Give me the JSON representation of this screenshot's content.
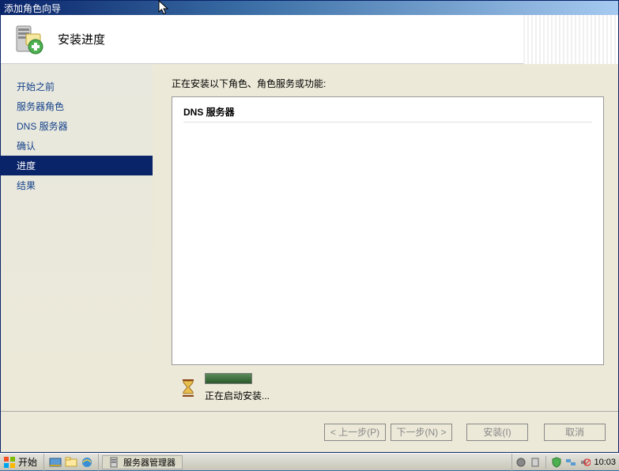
{
  "window": {
    "title": "添加角色向导",
    "header_title": "安装进度"
  },
  "sidebar": {
    "items": [
      {
        "label": "开始之前"
      },
      {
        "label": "服务器角色"
      },
      {
        "label": "DNS 服务器"
      },
      {
        "label": "确认"
      },
      {
        "label": "进度"
      },
      {
        "label": "结果"
      }
    ],
    "active_index": 4
  },
  "main": {
    "intro": "正在安装以下角色、角色服务或功能:",
    "content_item": "DNS 服务器",
    "progress_text": "正在启动安装..."
  },
  "buttons": {
    "prev": "< 上一步(P)",
    "next": "下一步(N) >",
    "install": "安装(I)",
    "cancel": "取消"
  },
  "taskbar": {
    "start": "开始",
    "task_label": "服务器管理器",
    "clock": "10:03"
  }
}
